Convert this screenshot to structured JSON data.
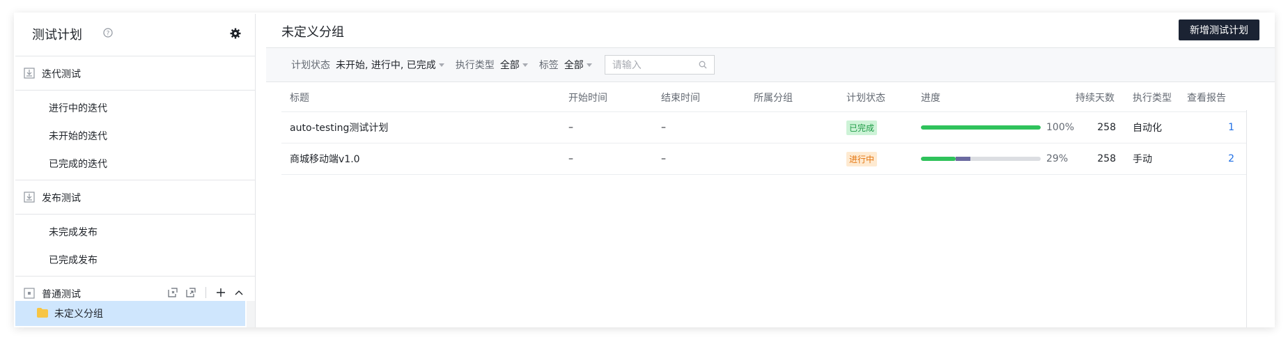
{
  "sidebar": {
    "title": "测试计划",
    "groups": {
      "iteration": {
        "label": "迭代测试",
        "items": [
          "进行中的迭代",
          "未开始的迭代",
          "已完成的迭代"
        ]
      },
      "release": {
        "label": "发布测试",
        "items": [
          "未完成发布",
          "已完成发布"
        ]
      },
      "normal": {
        "label": "普通测试",
        "items": [
          "未定义分组"
        ]
      }
    }
  },
  "main": {
    "title": "未定义分组",
    "add_button": "新增测试计划"
  },
  "filters": {
    "status_label": "计划状态",
    "status_value": "未开始, 进行中, 已完成",
    "exec_label": "执行类型",
    "exec_value": "全部",
    "tag_label": "标签",
    "tag_value": "全部",
    "search_placeholder": "请输入"
  },
  "table": {
    "columns": [
      "标题",
      "开始时间",
      "结束时间",
      "所属分组",
      "计划状态",
      "进度",
      "持续天数",
      "执行类型",
      "查看报告"
    ],
    "rows": [
      {
        "title": "auto-testing测试计划",
        "start": "–",
        "end": "–",
        "group": "",
        "status": "已完成",
        "progress_pct": "100%",
        "progress": 1.0,
        "progress_extra": 0,
        "days": "258",
        "exec": "自动化",
        "report": "1"
      },
      {
        "title": "商城移动端v1.0",
        "start": "–",
        "end": "–",
        "group": "",
        "status": "进行中",
        "progress_pct": "29%",
        "progress": 0.29,
        "progress_extra": 0.12,
        "days": "258",
        "exec": "手动",
        "report": "2"
      }
    ]
  },
  "colors": {
    "accent_dark": "#1b2333",
    "selected_bg": "#cfe6fd",
    "progress_green": "#2fc25b",
    "progress_purple": "#6b6aa0",
    "link_blue": "#1f6fe5",
    "done_badge": "#cdf3d7",
    "doing_badge": "#feead1",
    "folder_yellow": "#f7c544"
  }
}
